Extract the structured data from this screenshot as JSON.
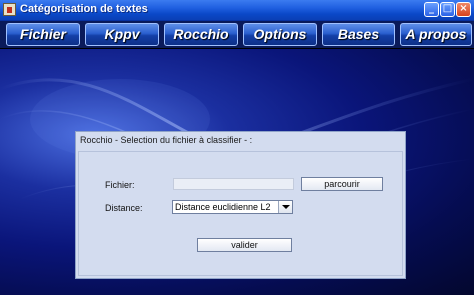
{
  "window": {
    "title": "Catégorisation de textes",
    "minimize_icon": "minimize-icon",
    "maximize_icon": "maximize-icon",
    "close_icon": "close-icon"
  },
  "menu": {
    "items": [
      {
        "label": "Fichier"
      },
      {
        "label": "Kppv"
      },
      {
        "label": "Rocchio"
      },
      {
        "label": "Options"
      },
      {
        "label": "Bases"
      },
      {
        "label": "A propos"
      }
    ]
  },
  "dialog": {
    "title": "Rocchio - Selection du fichier à classifier - :",
    "file_label": "Fichier:",
    "file_value": "",
    "browse_button": "parcourir",
    "distance_label": "Distance:",
    "distance_selected": "Distance euclidienne L2",
    "validate_button": "valider"
  },
  "colors": {
    "accent": "#2a5fcf",
    "titlebar": "#1f5fe0",
    "dialog_bg": "#d3dcef"
  }
}
